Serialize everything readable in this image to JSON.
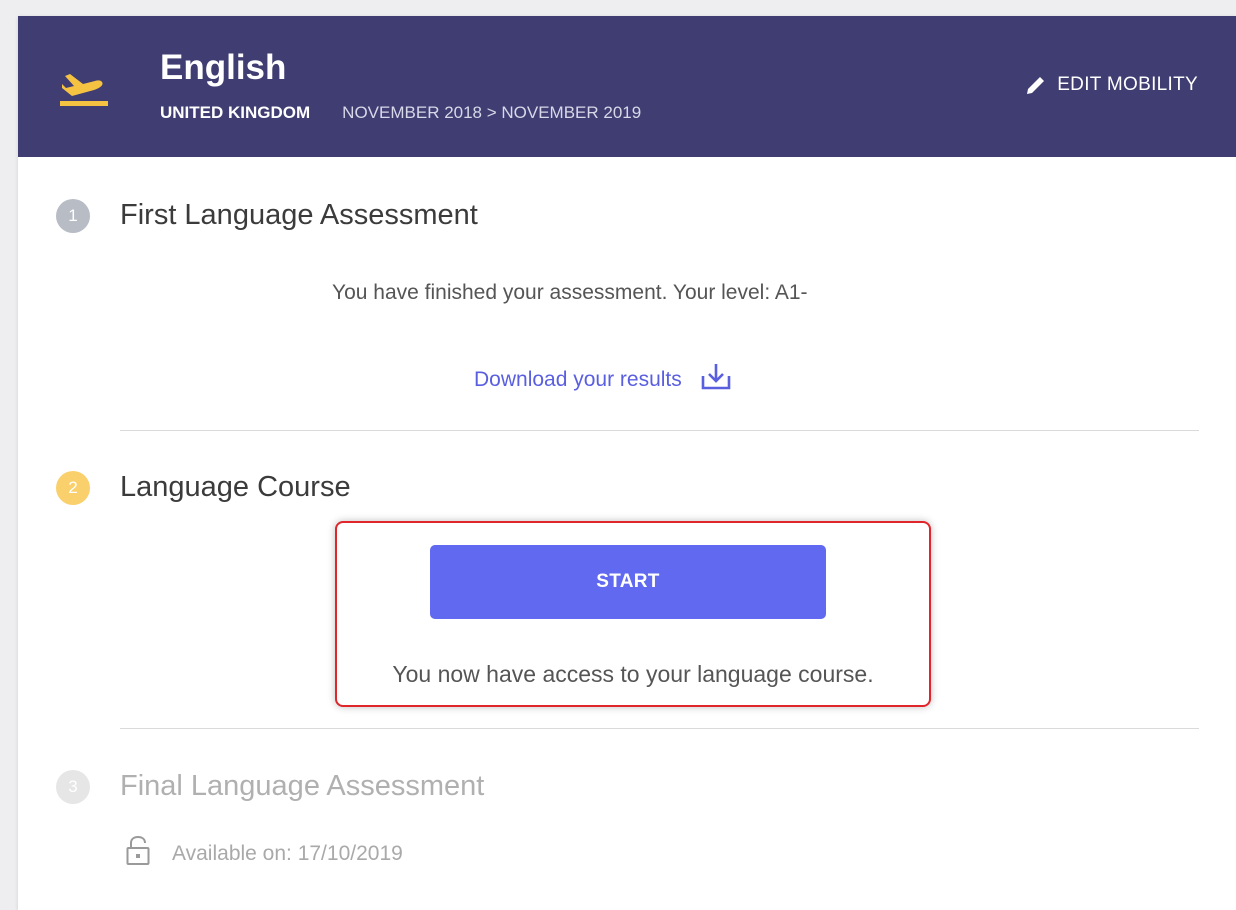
{
  "header": {
    "title": "English",
    "country": "UNITED KINGDOM",
    "dates": "NOVEMBER 2018 > NOVEMBER 2019",
    "edit_label": "EDIT MOBILITY",
    "icon": "plane-departure-icon",
    "accent_color": "#f5c242",
    "background_color": "#3f3d72"
  },
  "steps": [
    {
      "number": "1",
      "title": "First Language Assessment",
      "message": "You have finished your assessment. Your level: A1-",
      "download_label": "Download your results",
      "status_color": "#b7bcc5"
    },
    {
      "number": "2",
      "title": "Language Course",
      "start_label": "START",
      "message": "You now have access to your language course.",
      "status_color": "#f9d06b",
      "button_color": "#6069ef"
    },
    {
      "number": "3",
      "title": "Final Language Assessment",
      "availability": "Available on: 17/10/2019",
      "status_color": "#e6e6e6",
      "locked": true
    }
  ]
}
